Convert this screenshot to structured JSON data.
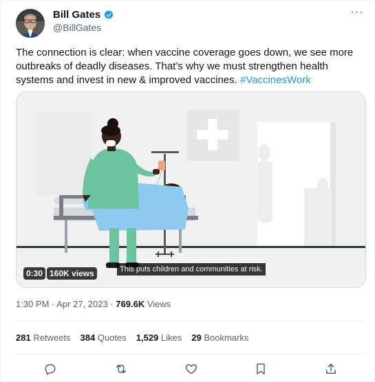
{
  "author": {
    "name": "Bill Gates",
    "handle": "@BillGates",
    "verified": true
  },
  "more_menu": "···",
  "tweet": {
    "text": "The connection is clear: when vaccine coverage goes down, we see more outbreaks of deadly diseases. That’s why we must strengthen health systems and invest in new & improved vaccines. ",
    "hashtag": "#VaccinesWork"
  },
  "video": {
    "caption": "This puts children and communities at risk.",
    "duration": "0:30",
    "views": "160K views"
  },
  "meta": {
    "time": "1:30 PM",
    "separator1": " · ",
    "date": "Apr 27, 2023",
    "separator2": " · ",
    "views_count": "769.6K",
    "views_label": " Views"
  },
  "stats": {
    "retweets_count": "281",
    "retweets_label": " Retweets",
    "quotes_count": "384",
    "quotes_label": " Quotes",
    "likes_count": "1,529",
    "likes_label": " Likes",
    "bookmarks_count": "29",
    "bookmarks_label": " Bookmarks"
  },
  "icons": {
    "reply": "reply-icon",
    "retweet": "retweet-icon",
    "like": "heart-icon",
    "bookmark": "bookmark-icon",
    "share": "share-icon"
  },
  "colors": {
    "link": "#1d9bf0",
    "secondary_text": "#536471",
    "nurse_scrubs": "#6cc3a0",
    "blanket": "#8ec9ef"
  }
}
